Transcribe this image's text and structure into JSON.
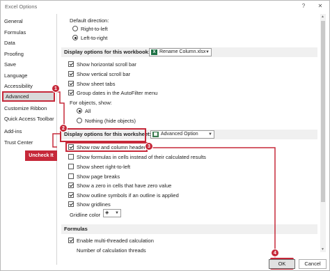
{
  "window": {
    "title": "Excel Options",
    "help": "?",
    "close": "✕"
  },
  "sidebar": {
    "items": [
      {
        "label": "General"
      },
      {
        "label": "Formulas"
      },
      {
        "label": "Data"
      },
      {
        "label": "Proofing"
      },
      {
        "label": "Save"
      },
      {
        "label": "Language"
      },
      {
        "label": "Accessibility"
      },
      {
        "label": "Advanced"
      },
      {
        "label": "Customize Ribbon"
      },
      {
        "label": "Quick Access Toolbar"
      },
      {
        "label": "Add-ins"
      },
      {
        "label": "Trust Center"
      }
    ]
  },
  "content": {
    "default_direction_label": "Default direction:",
    "rtl_label": "Right-to-left",
    "ltr_label": "Left-to-right",
    "workbook_section": "Display options for this workbook:",
    "workbook_value": "Rename Column.xlsx",
    "wb_options": [
      {
        "label": "Show horizontal scroll bar",
        "checked": true
      },
      {
        "label": "Show vertical scroll bar",
        "checked": true
      },
      {
        "label": "Show sheet tabs",
        "checked": true
      },
      {
        "label": "Group dates in the AutoFilter menu",
        "checked": true
      }
    ],
    "objects_label": "For objects, show:",
    "all_label": "All",
    "nothing_label": "Nothing (hide objects)",
    "worksheet_section": "Display options for this worksheet:",
    "worksheet_value": "Advanced Option",
    "ws_options": [
      {
        "label": "Show row and column headers",
        "checked": true
      },
      {
        "label": "Show formulas in cells instead of their calculated results",
        "checked": false
      },
      {
        "label": "Show sheet right-to-left",
        "checked": false
      },
      {
        "label": "Show page breaks",
        "checked": false
      },
      {
        "label": "Show a zero in cells that have zero value",
        "checked": true
      },
      {
        "label": "Show outline symbols if an outline is applied",
        "checked": true
      },
      {
        "label": "Show gridlines",
        "checked": true
      }
    ],
    "gridline_label": "Gridline color",
    "formulas_section": "Formulas",
    "multithread_label": "Enable multi-threaded calculation",
    "threads_label": "Number of calculation threads"
  },
  "annotations": {
    "badges": [
      "1",
      "2",
      "3",
      "4"
    ],
    "callout": "Uncheck It",
    "accent": "#c62839"
  },
  "buttons": {
    "ok": "OK",
    "cancel": "Cancel"
  }
}
